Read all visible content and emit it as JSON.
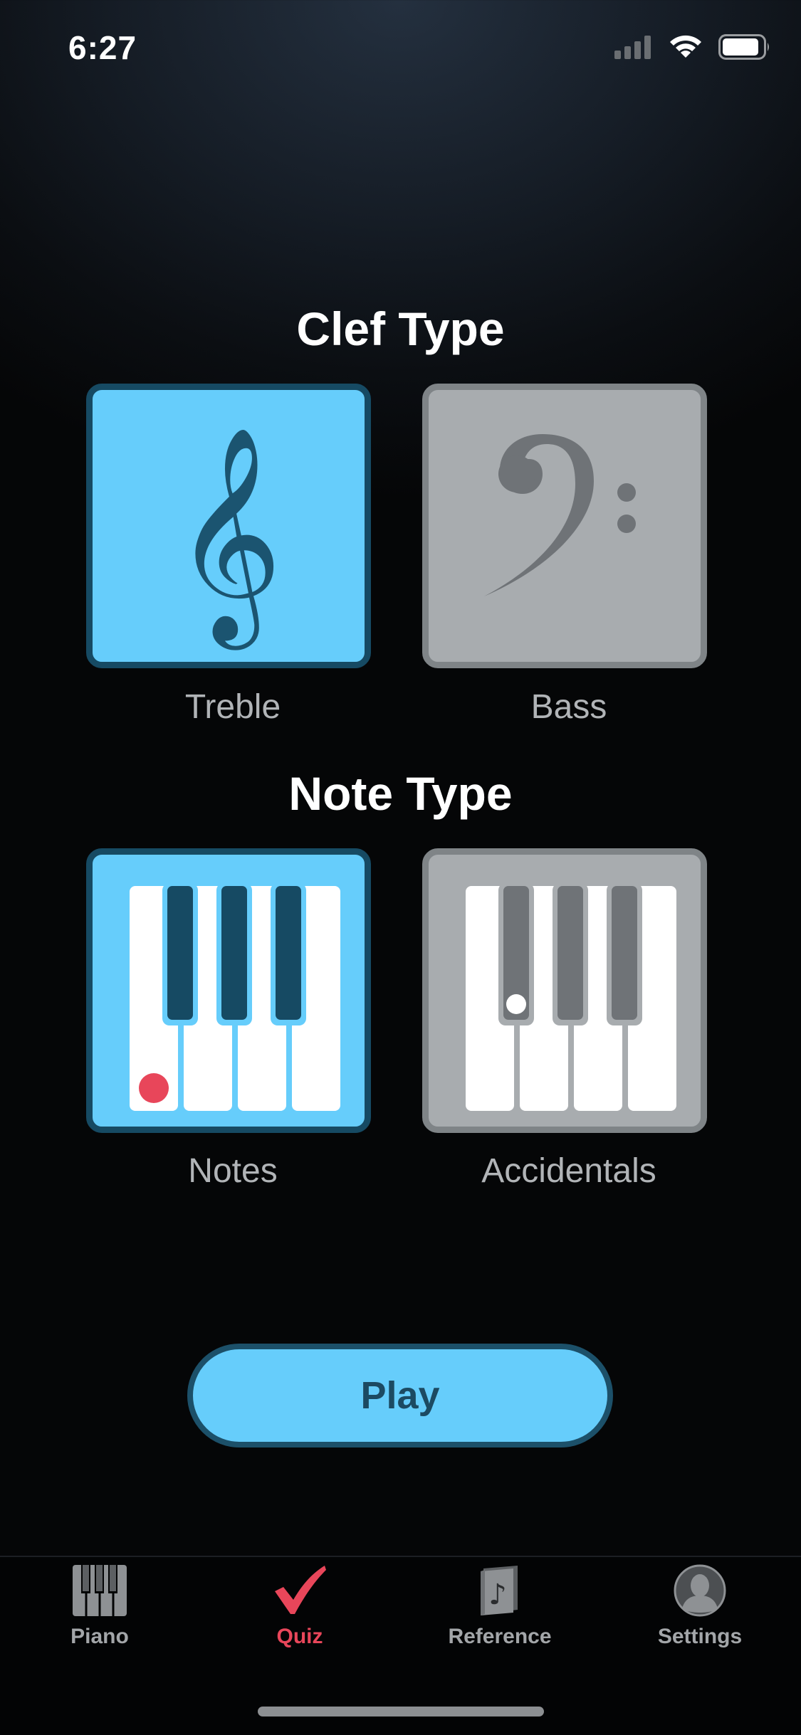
{
  "status_bar": {
    "time": "6:27",
    "icons": [
      "cellular-signal-icon",
      "wifi-icon",
      "battery-icon"
    ]
  },
  "clef_section": {
    "title": "Clef Type",
    "options": [
      {
        "label": "Treble",
        "icon": "treble-clef-icon",
        "selected": true
      },
      {
        "label": "Bass",
        "icon": "bass-clef-icon",
        "selected": false
      }
    ]
  },
  "note_section": {
    "title": "Note Type",
    "options": [
      {
        "label": "Notes",
        "icon": "piano-keys-natural-icon",
        "selected": true
      },
      {
        "label": "Accidentals",
        "icon": "piano-keys-accidental-icon",
        "selected": false
      }
    ]
  },
  "play_button": {
    "label": "Play"
  },
  "tab_bar": {
    "active": "Quiz",
    "tabs": [
      {
        "label": "Piano",
        "icon": "piano-icon"
      },
      {
        "label": "Quiz",
        "icon": "checkmark-icon"
      },
      {
        "label": "Reference",
        "icon": "music-book-icon"
      },
      {
        "label": "Settings",
        "icon": "profile-icon"
      }
    ]
  },
  "colors": {
    "accent": "#66cdfb",
    "accent_border": "#164a63",
    "unselected": "#a8acaf",
    "active_tab": "#e8465a",
    "note_dot": "#e8465a"
  }
}
